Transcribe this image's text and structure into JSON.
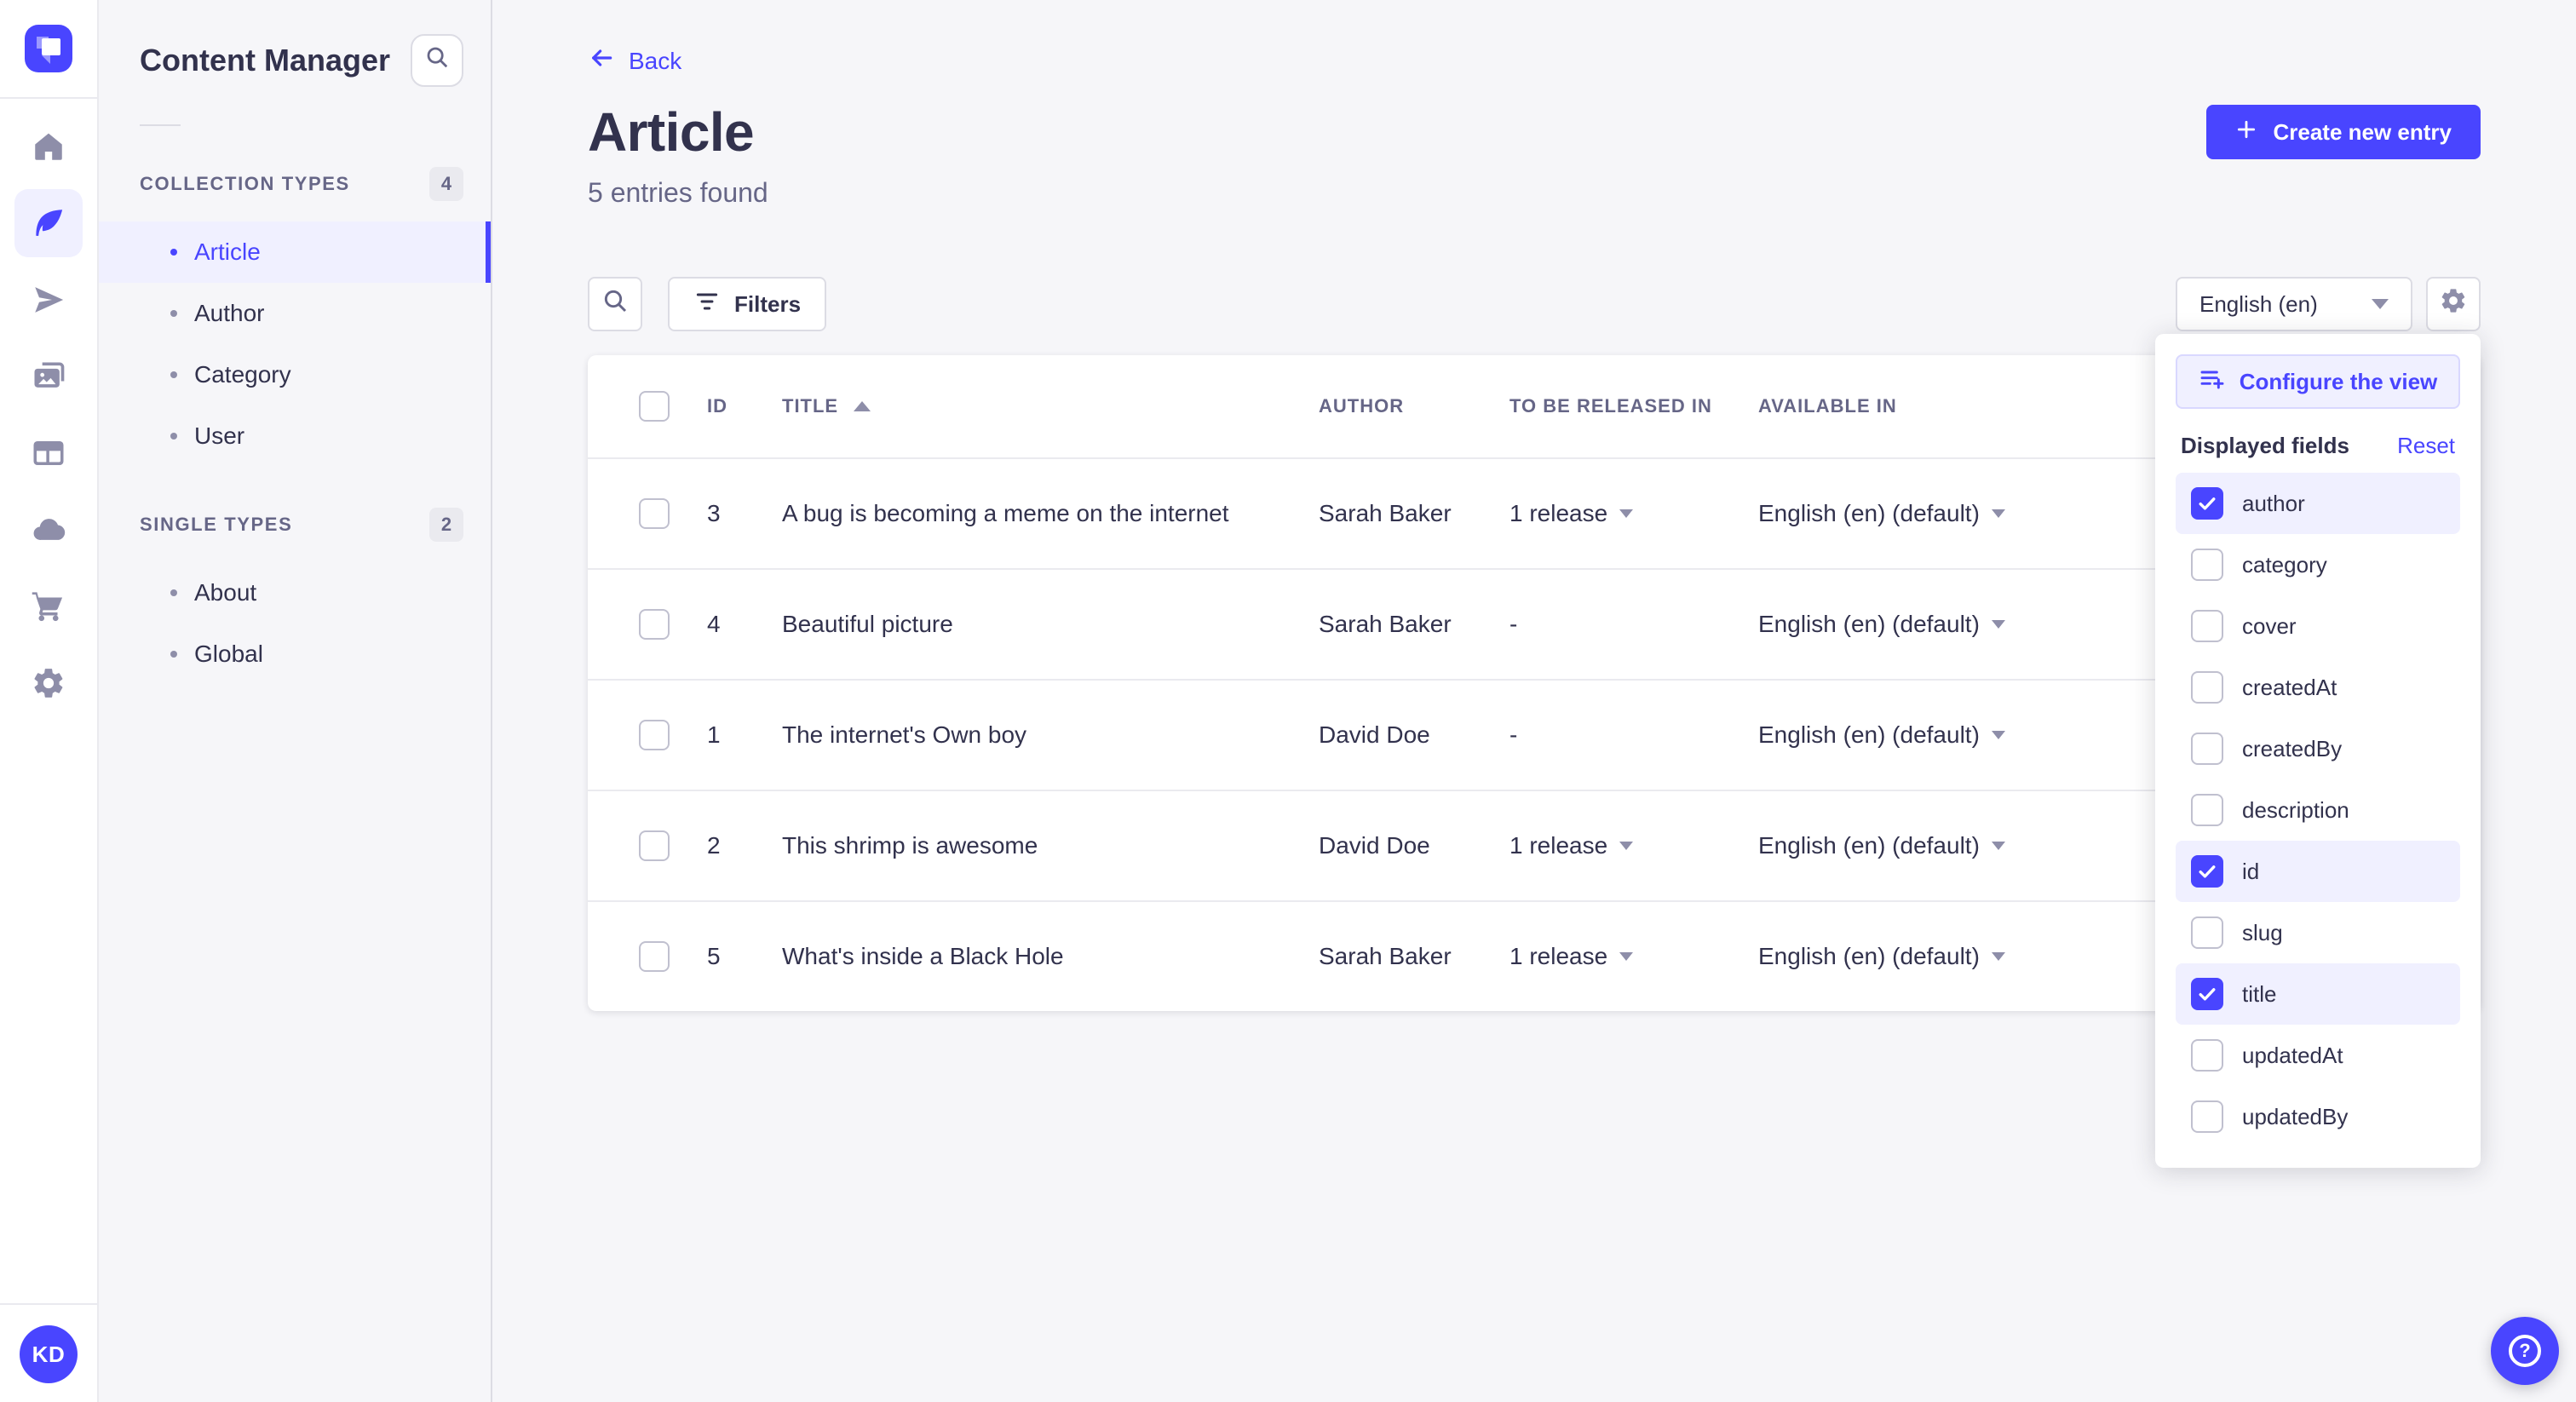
{
  "colors": {
    "primary": "#4945FF",
    "primary_light": "#F0F0FF",
    "primary_border": "#D9D8FF",
    "app_bg": "#F6F6F9",
    "surface": "#FFFFFF",
    "border": "#DCDCE4",
    "text_dark": "#32324D",
    "text_mid": "#666687",
    "icon_gray": "#8E8EA9"
  },
  "rail": {
    "logo": "strapi-logo",
    "items": [
      {
        "name": "home",
        "active": false
      },
      {
        "name": "content-manager",
        "active": true
      },
      {
        "name": "releases",
        "active": false
      },
      {
        "name": "media-library",
        "active": false
      },
      {
        "name": "content-type-builder",
        "active": false
      },
      {
        "name": "cloud",
        "active": false
      },
      {
        "name": "marketplace",
        "active": false
      },
      {
        "name": "settings",
        "active": false
      }
    ],
    "avatar_initials": "KD"
  },
  "subnav": {
    "title": "Content Manager",
    "sections": [
      {
        "label": "COLLECTION TYPES",
        "badge": "4",
        "items": [
          {
            "label": "Article",
            "active": true
          },
          {
            "label": "Author",
            "active": false
          },
          {
            "label": "Category",
            "active": false
          },
          {
            "label": "User",
            "active": false
          }
        ]
      },
      {
        "label": "SINGLE TYPES",
        "badge": "2",
        "items": [
          {
            "label": "About",
            "active": false
          },
          {
            "label": "Global",
            "active": false
          }
        ]
      }
    ]
  },
  "page": {
    "back_label": "Back",
    "title": "Article",
    "subtitle": "5 entries found",
    "create_button": "Create new entry"
  },
  "toolbar": {
    "filters_label": "Filters",
    "locale_value": "English (en)"
  },
  "table": {
    "headers": {
      "id": "ID",
      "title": "TITLE",
      "author": "AUTHOR",
      "released": "TO BE RELEASED IN",
      "available": "AVAILABLE IN"
    },
    "sorted_by": "TITLE",
    "sort_direction": "ascending",
    "rows": [
      {
        "id": "3",
        "title": "A bug is becoming a meme on the internet",
        "author": "Sarah Baker",
        "released": "1 release",
        "has_release_dropdown": true,
        "available": "English (en) (default)"
      },
      {
        "id": "4",
        "title": "Beautiful picture",
        "author": "Sarah Baker",
        "released": "-",
        "has_release_dropdown": false,
        "available": "English (en) (default)"
      },
      {
        "id": "1",
        "title": "The internet's Own boy",
        "author": "David Doe",
        "released": "-",
        "has_release_dropdown": false,
        "available": "English (en) (default)"
      },
      {
        "id": "2",
        "title": "This shrimp is awesome",
        "author": "David Doe",
        "released": "1 release",
        "has_release_dropdown": true,
        "available": "English (en) (default)"
      },
      {
        "id": "5",
        "title": "What's inside a Black Hole",
        "author": "Sarah Baker",
        "released": "1 release",
        "has_release_dropdown": true,
        "available": "English (en) (default)"
      }
    ]
  },
  "popover": {
    "configure_button": "Configure the view",
    "fields_title": "Displayed fields",
    "reset_label": "Reset",
    "fields": [
      {
        "label": "author",
        "checked": true
      },
      {
        "label": "category",
        "checked": false
      },
      {
        "label": "cover",
        "checked": false
      },
      {
        "label": "createdAt",
        "checked": false
      },
      {
        "label": "createdBy",
        "checked": false
      },
      {
        "label": "description",
        "checked": false
      },
      {
        "label": "id",
        "checked": true
      },
      {
        "label": "slug",
        "checked": false
      },
      {
        "label": "title",
        "checked": true
      },
      {
        "label": "updatedAt",
        "checked": false
      },
      {
        "label": "updatedBy",
        "checked": false
      }
    ]
  },
  "help": {
    "icon": "question-mark"
  }
}
